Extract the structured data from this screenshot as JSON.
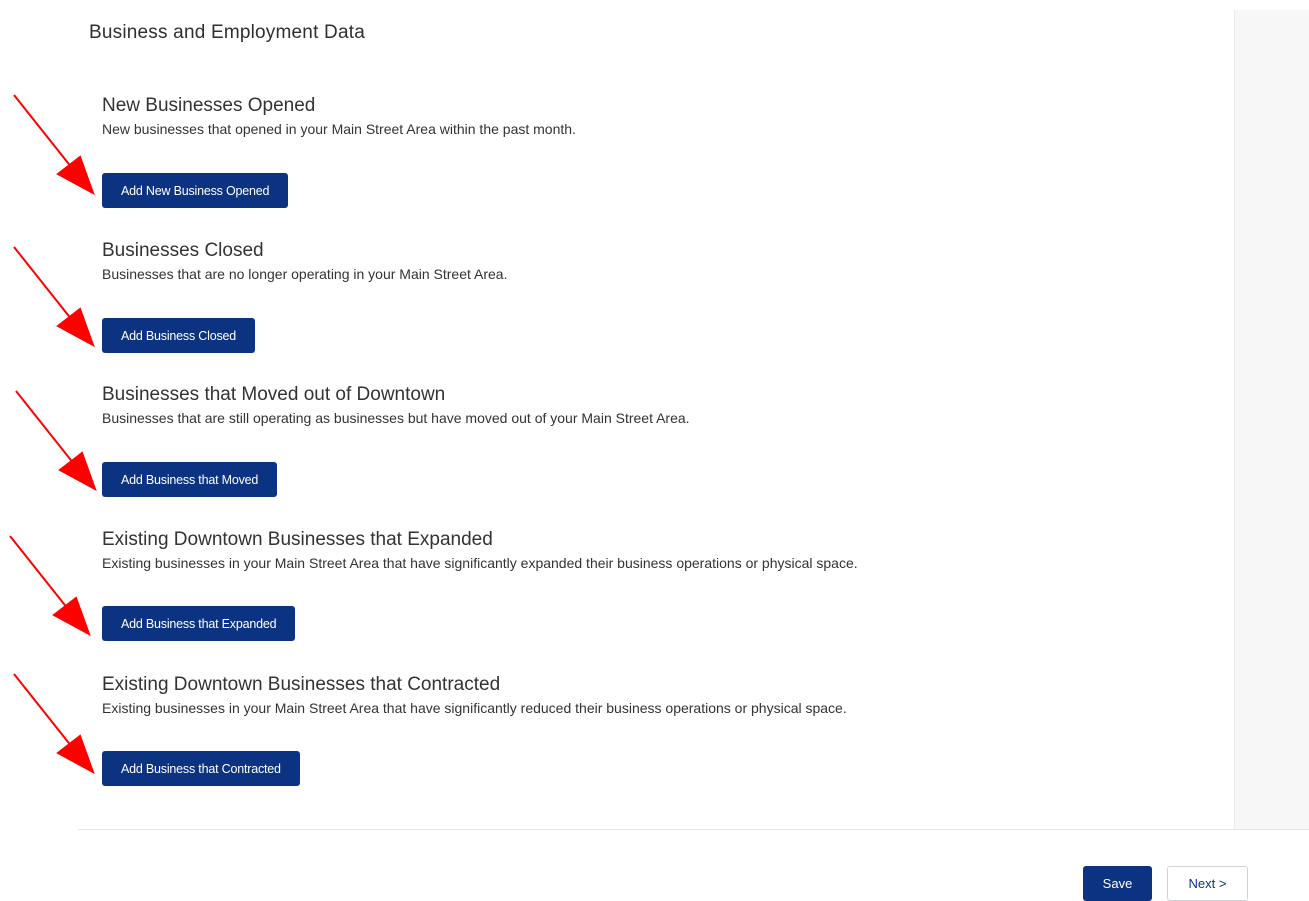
{
  "page_title": "Business and Employment Data",
  "colors": {
    "primary_button": "#0c3382",
    "arrow": "#ff0000"
  },
  "sections": [
    {
      "title": "New Businesses Opened",
      "description": "New businesses that opened in your Main Street Area within the past month.",
      "button_label": "Add New Business Opened"
    },
    {
      "title": "Businesses Closed",
      "description": "Businesses that are no longer operating in your Main Street Area.",
      "button_label": "Add Business Closed"
    },
    {
      "title": "Businesses that Moved out of Downtown",
      "description": "Businesses that are still operating as businesses but have moved out of your Main Street Area.",
      "button_label": "Add Business that Moved"
    },
    {
      "title": "Existing Downtown Businesses that Expanded",
      "description": "Existing businesses in your Main Street Area that have significantly expanded their business operations or physical space.",
      "button_label": "Add Business that Expanded"
    },
    {
      "title": "Existing Downtown Businesses that Contracted",
      "description": "Existing businesses in your Main Street Area that have significantly reduced their business operations or physical space.",
      "button_label": "Add Business that Contracted"
    }
  ],
  "footer": {
    "save_label": "Save",
    "next_label": "Next >"
  }
}
